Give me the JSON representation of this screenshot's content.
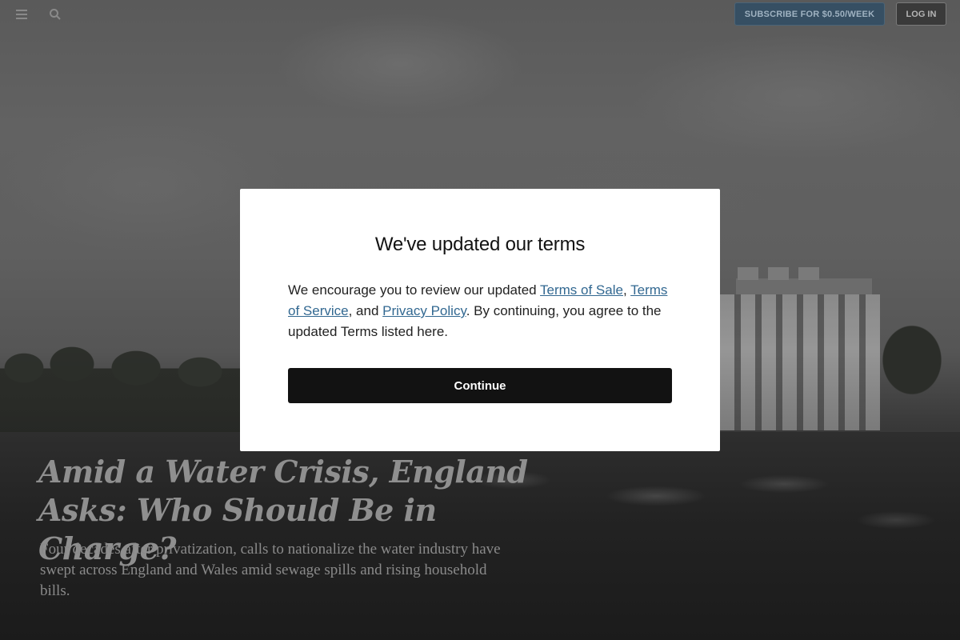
{
  "header": {
    "menu_icon": "hamburger-menu-icon",
    "search_icon": "search-icon",
    "subscribe_label": "SUBSCRIBE FOR $0.50/WEEK",
    "login_label": "LOG IN"
  },
  "article": {
    "headline_line1": "Amid a Water Crisis, England",
    "headline_line2": "Asks: Who Should Be in Charge?",
    "summary": "Four decades after privatization, calls to nationalize the water industry have swept across England and Wales amid sewage spills and rising household bills."
  },
  "modal": {
    "title": "We've updated our terms",
    "body_intro": "We encourage you to review our updated ",
    "link_terms_of_sale": "Terms of Sale",
    "sep1": ", ",
    "link_terms_of_service": "Terms of Service",
    "sep2": ", and ",
    "link_privacy_policy": "Privacy Policy",
    "body_outro": ". By continuing, you agree to the updated Terms listed here.",
    "continue_label": "Continue"
  },
  "colors": {
    "link": "#326891",
    "button_dark": "#121212",
    "subscribe_bg": "#364f63"
  }
}
